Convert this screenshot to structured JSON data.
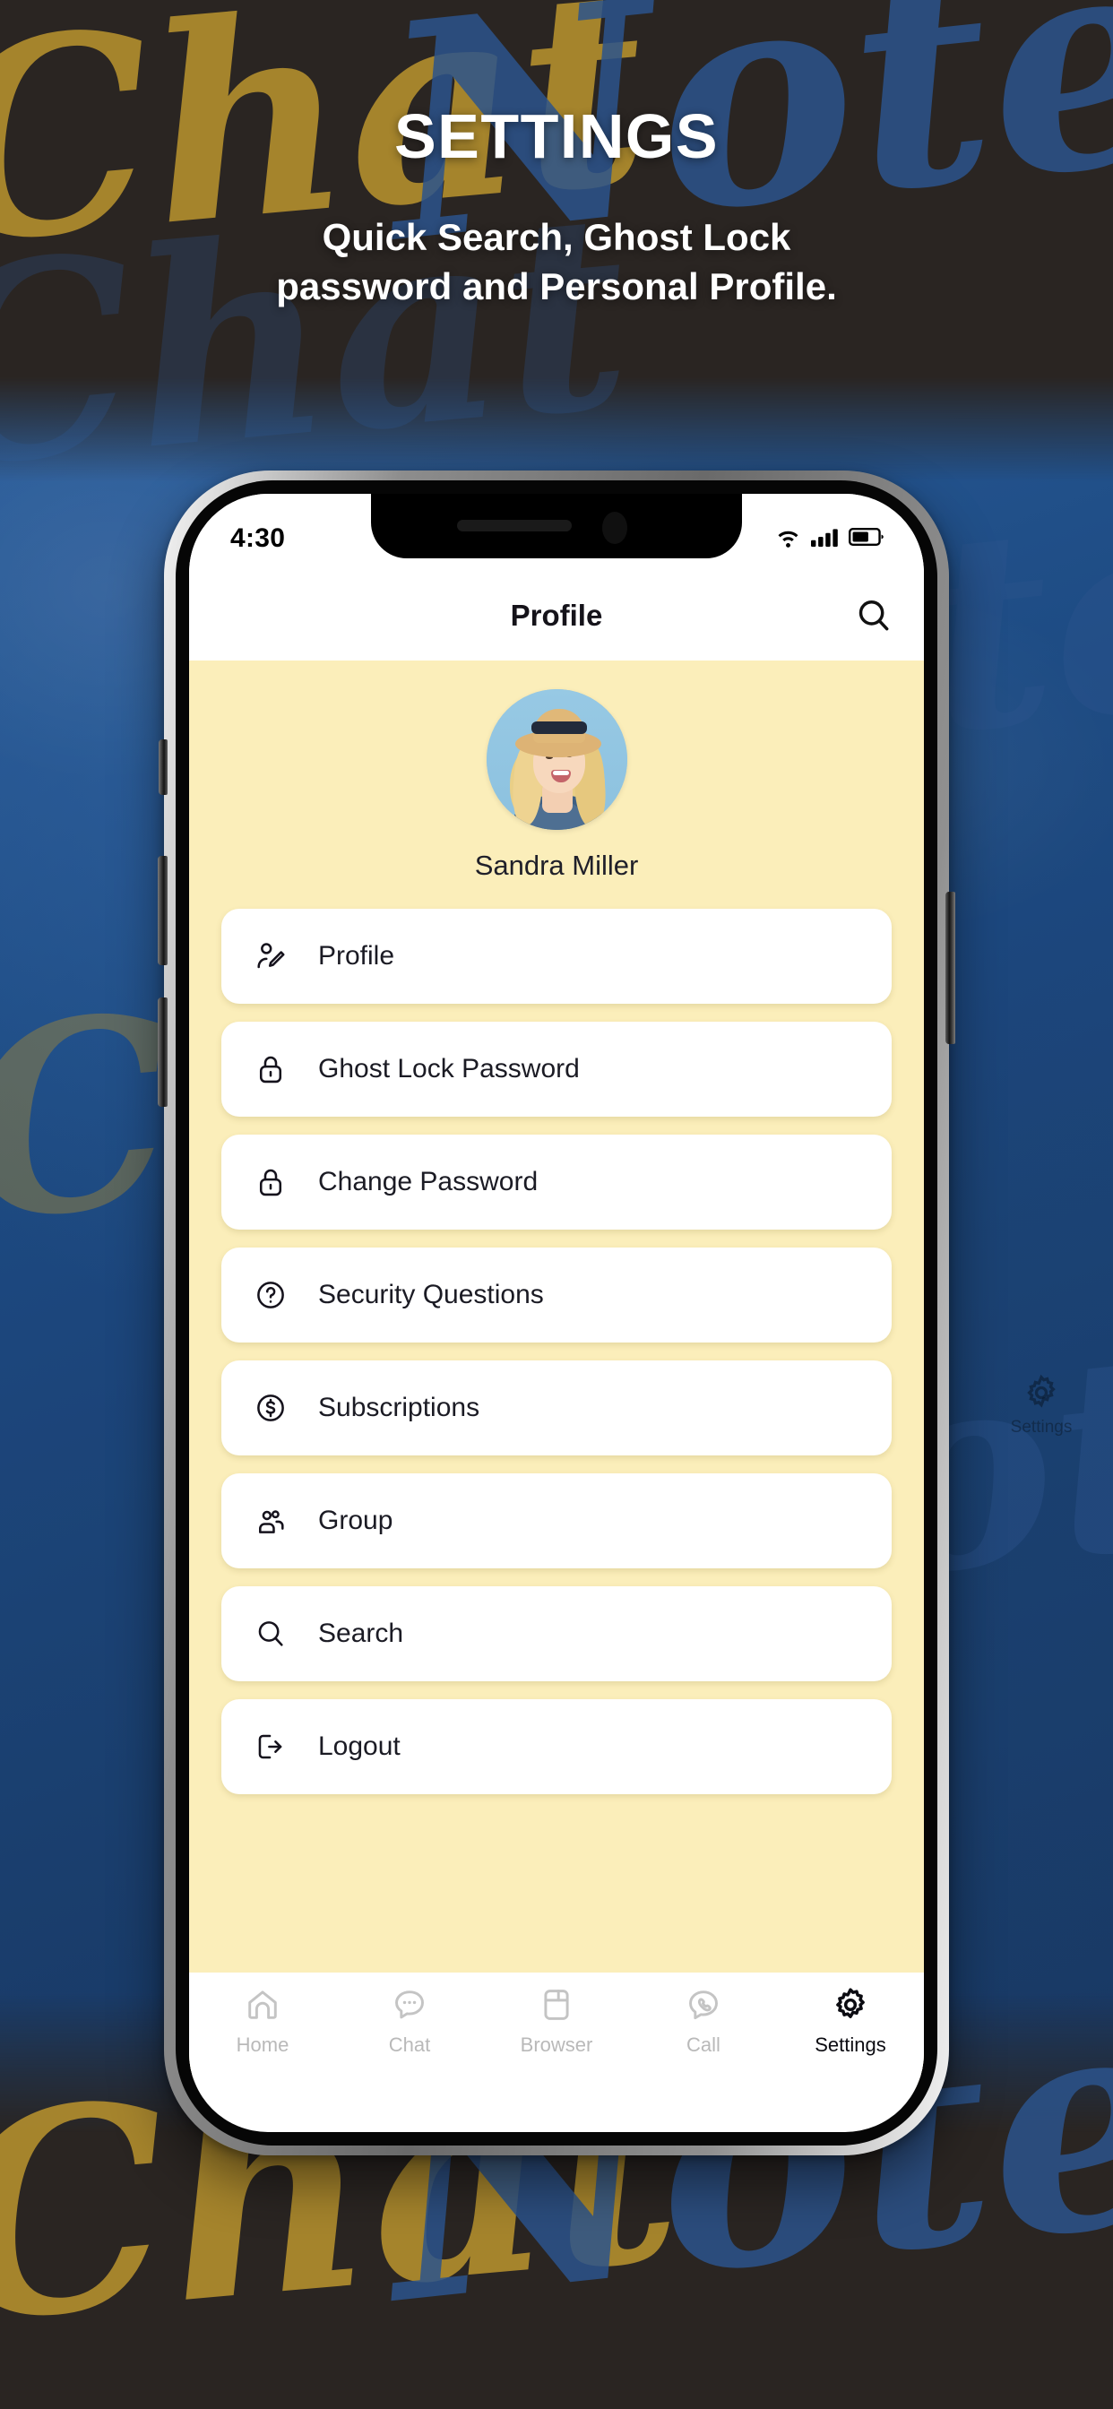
{
  "promo": {
    "title": "SETTINGS",
    "subtitle_line1": "Quick Search,  Ghost Lock",
    "subtitle_line2": "password and Personal Profile.",
    "background_words": [
      "Chat",
      "Notes",
      "Chat",
      "Notes",
      "Chat",
      "Notes",
      "Chat",
      "Notes",
      "Chat"
    ],
    "background_watermark_label": "Settings",
    "colors": {
      "dark": "#2a2522",
      "blue": "#1d4d87",
      "gold": "#b08c2e",
      "title_text": "#ffffff"
    }
  },
  "phone": {
    "status_bar": {
      "time": "4:30",
      "icons": [
        "wifi-icon",
        "cellular-signal-icon",
        "battery-icon"
      ]
    },
    "app_bar": {
      "title": "Profile",
      "search_icon": "search-icon"
    },
    "profile": {
      "name": "Sandra Miller",
      "avatar_alt": "avatar"
    },
    "menu": {
      "items": [
        {
          "label": "Profile",
          "icon": "profile-edit-icon"
        },
        {
          "label": "Ghost Lock Password",
          "icon": "lock-icon"
        },
        {
          "label": "Change Password",
          "icon": "lock-icon"
        },
        {
          "label": "Security Questions",
          "icon": "question-circle-icon"
        },
        {
          "label": "Subscriptions",
          "icon": "dollar-circle-icon"
        },
        {
          "label": "Group",
          "icon": "group-icon"
        },
        {
          "label": "Search",
          "icon": "search-icon"
        },
        {
          "label": "Logout",
          "icon": "logout-icon"
        }
      ]
    },
    "tabs": [
      {
        "label": "Home",
        "icon": "home-icon",
        "active": false
      },
      {
        "label": "Chat",
        "icon": "chat-icon",
        "active": false
      },
      {
        "label": "Browser",
        "icon": "browser-icon",
        "active": false
      },
      {
        "label": "Call",
        "icon": "call-icon",
        "active": false
      },
      {
        "label": "Settings",
        "icon": "gear-icon",
        "active": true
      }
    ],
    "theme": {
      "screen_background": "#fbeeba",
      "card_background": "#ffffff",
      "inactive_tab": "#b9b9b9",
      "active_tab": "#0c0c12"
    }
  }
}
